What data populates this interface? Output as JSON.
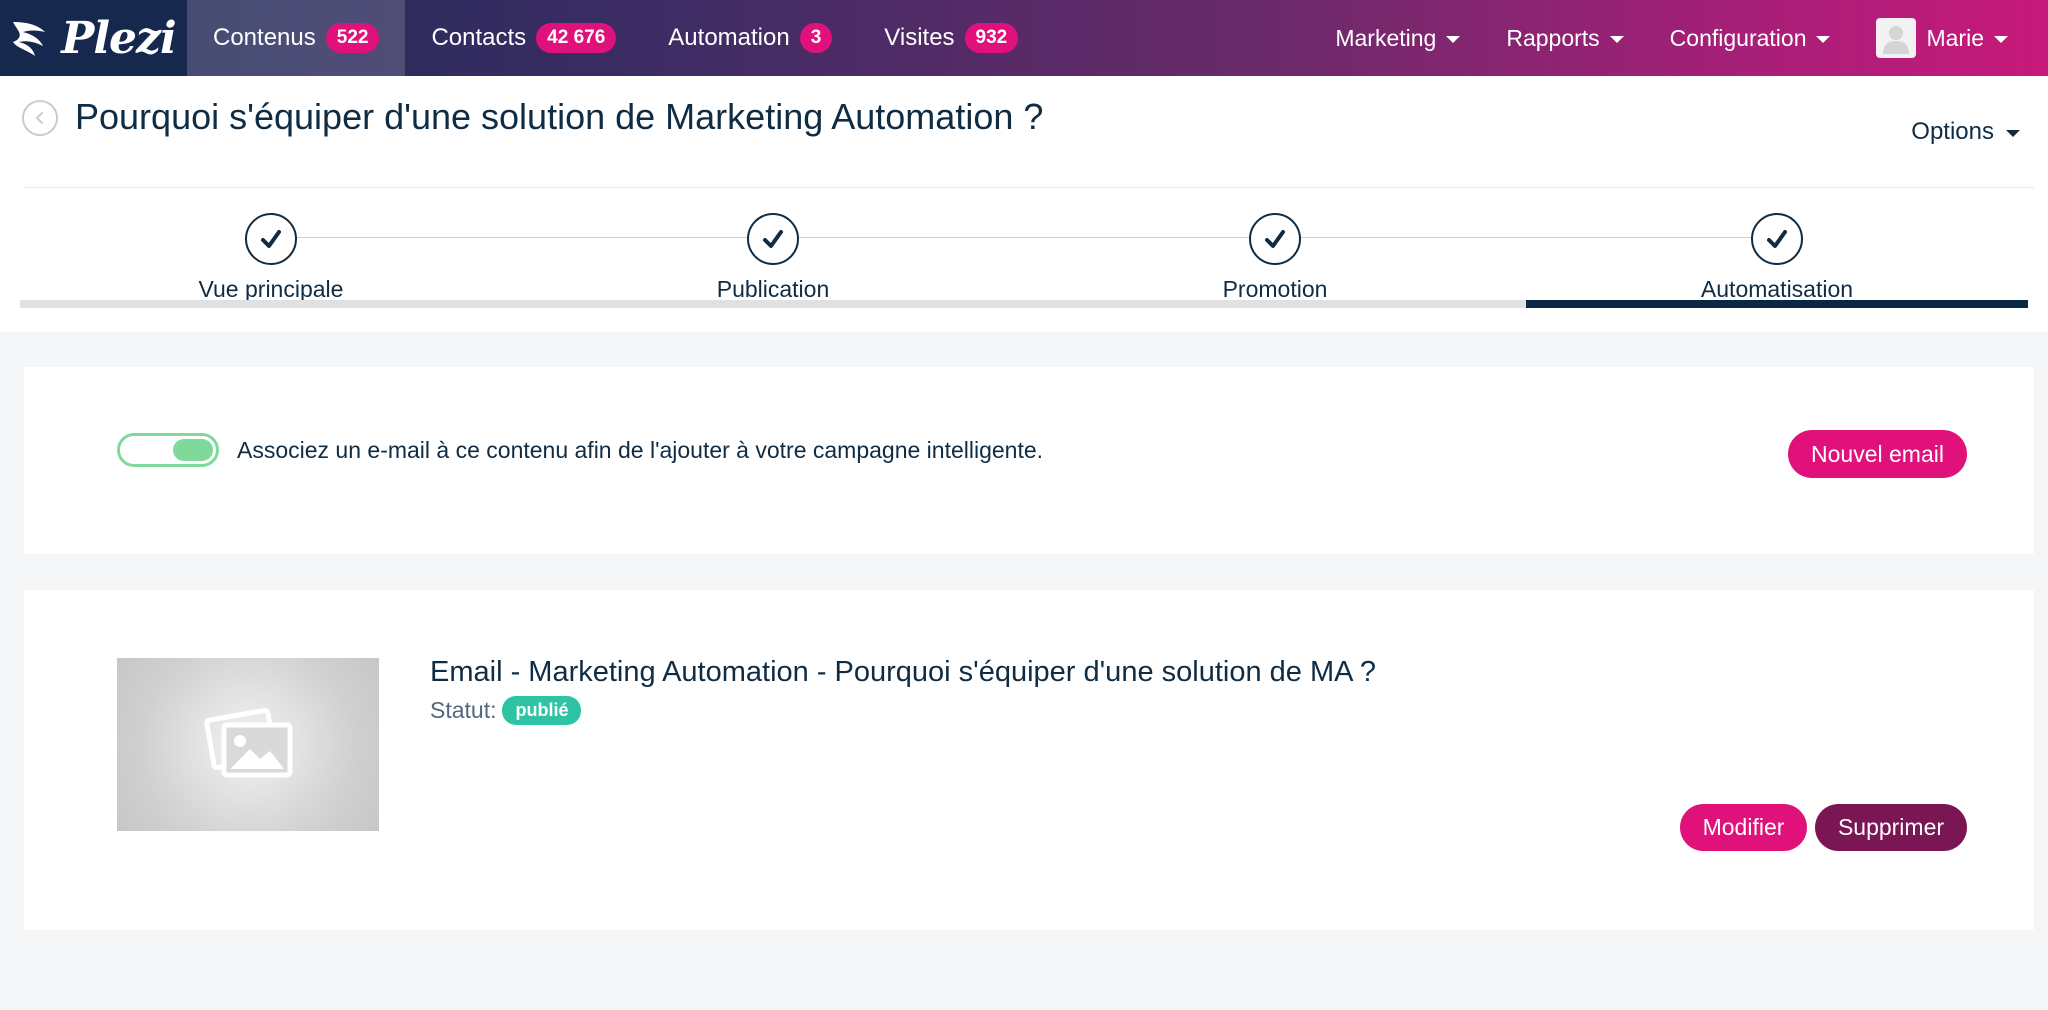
{
  "brand": {
    "name": "Plezi"
  },
  "nav": {
    "items": [
      {
        "label": "Contenus",
        "badge": "522"
      },
      {
        "label": "Contacts",
        "badge": "42 676"
      },
      {
        "label": "Automation",
        "badge": "3"
      },
      {
        "label": "Visites",
        "badge": "932"
      }
    ],
    "menus": [
      "Marketing",
      "Rapports",
      "Configuration"
    ],
    "user": {
      "name": "Marie"
    }
  },
  "page": {
    "title": "Pourquoi s'équiper d'une solution de Marketing Automation ?",
    "options_label": "Options"
  },
  "stepper": {
    "steps": [
      {
        "label": "Vue principale"
      },
      {
        "label": "Publication"
      },
      {
        "label": "Promotion"
      },
      {
        "label": "Automatisation"
      }
    ],
    "active": "Automatisation"
  },
  "automation": {
    "toggle_on": true,
    "toggle_text": "Associez un e-mail à ce contenu afin de l'ajouter à votre campagne intelligente.",
    "new_email_label": "Nouvel email"
  },
  "email": {
    "title": "Email - Marketing Automation - Pourquoi s'équiper d'une solution de MA ?",
    "status_label": "Statut:",
    "status_value": "publié",
    "edit_label": "Modifier",
    "delete_label": "Supprimer"
  },
  "colors": {
    "accent": "#e0117a",
    "navy": "#0f2c45",
    "danger": "#7b1654",
    "success": "#2ec4a3",
    "toggle": "#7ed99a"
  }
}
